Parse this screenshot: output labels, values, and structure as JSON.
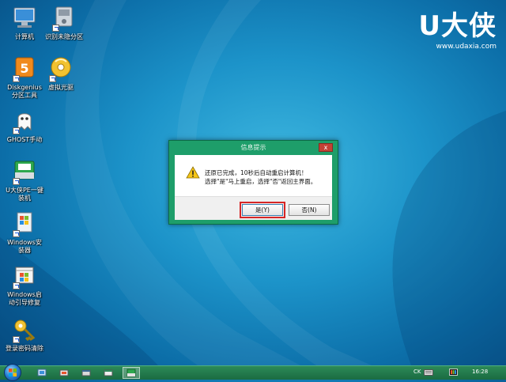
{
  "brand": {
    "name": "U大侠",
    "url": "www.udaxia.com"
  },
  "desktop_icons": [
    {
      "label_line1": "计算机",
      "label_line2": "",
      "icon": "computer-icon"
    },
    {
      "label_line1": "识别未隐分区",
      "label_line2": "",
      "icon": "drive-icon"
    },
    {
      "label_line1": "Diskgenius",
      "label_line2": "分区工具",
      "icon": "diskgenius-icon"
    },
    {
      "label_line1": "虚拟光驱",
      "label_line2": "",
      "icon": "virtual-cd-icon"
    },
    {
      "label_line1": "GHOST手动",
      "label_line2": "",
      "icon": "ghost-icon"
    },
    {
      "label_line1": "U大侠PE一键",
      "label_line2": "装机",
      "icon": "udaxia-installer-icon"
    },
    {
      "label_line1": "Windows安",
      "label_line2": "装器",
      "icon": "windows-setup-icon"
    },
    {
      "label_line1": "Windows启",
      "label_line2": "动引导修复",
      "icon": "boot-repair-icon"
    },
    {
      "label_line1": "登录密码清除",
      "label_line2": "",
      "icon": "password-key-icon"
    }
  ],
  "dialog": {
    "title": "信息提示",
    "close_label": "x",
    "message_line1": "还原已完成，10秒后自动重启计算机！",
    "message_line2": "选择\"是\"马上重启，选择\"否\"返回主界面。",
    "yes_label": "是(Y)",
    "no_label": "否(N)",
    "icon": "warning-icon"
  },
  "taskbar": {
    "language": "CK",
    "clock": "16:28"
  },
  "colors": {
    "dialog_frame": "#1e9e6a",
    "taskbar": "#1b6b41",
    "default_button_highlight": "#d62626"
  }
}
